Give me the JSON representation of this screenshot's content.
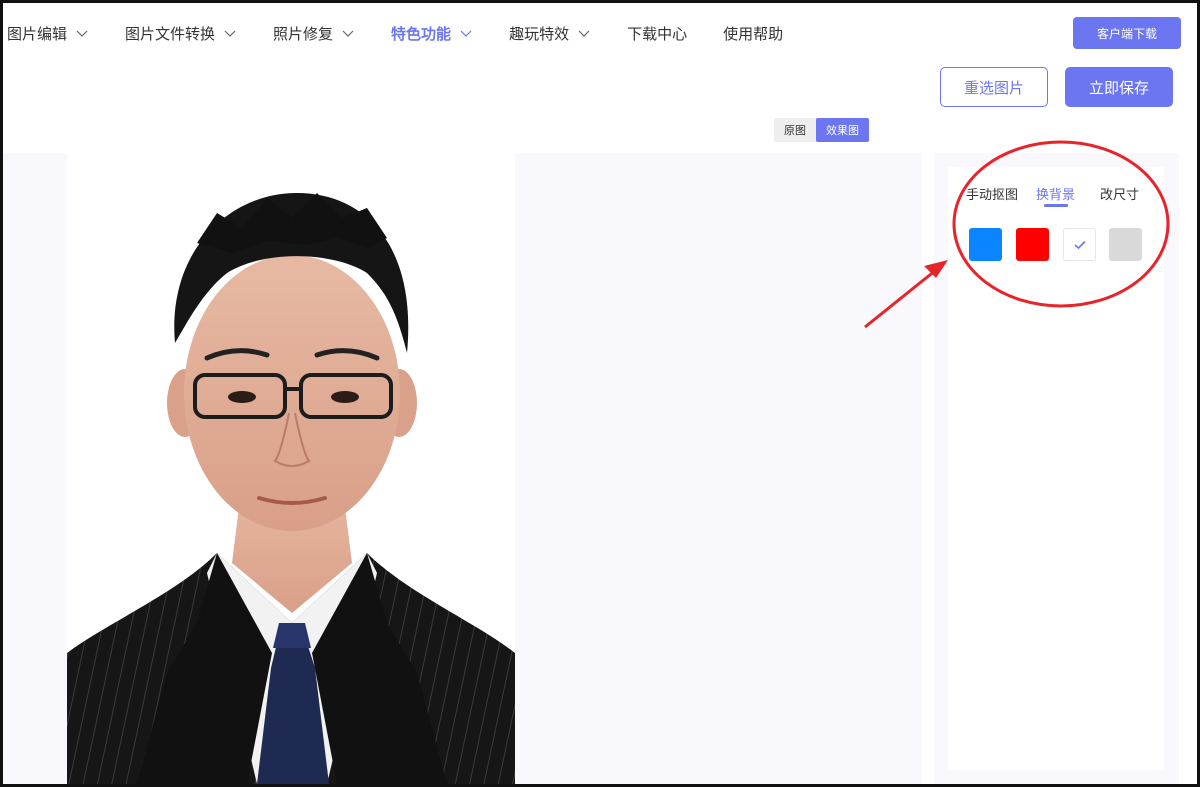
{
  "nav": {
    "items": [
      {
        "label": "图片编辑",
        "has_dropdown": true
      },
      {
        "label": "图片文件转换",
        "has_dropdown": true
      },
      {
        "label": "照片修复",
        "has_dropdown": true
      },
      {
        "label": "特色功能",
        "has_dropdown": true,
        "active": true
      },
      {
        "label": "趣玩特效",
        "has_dropdown": true
      },
      {
        "label": "下载中心",
        "has_dropdown": false
      },
      {
        "label": "使用帮助",
        "has_dropdown": false
      }
    ],
    "download_client_label": "客户端下载"
  },
  "actions": {
    "reselect_label": "重选图片",
    "save_label": "立即保存"
  },
  "view_toggle": {
    "original_label": "原图",
    "effect_label": "效果图",
    "selected": "效果图"
  },
  "panel": {
    "tabs": [
      {
        "label": "手动抠图"
      },
      {
        "label": "换背景",
        "active": true
      },
      {
        "label": "改尺寸"
      }
    ],
    "swatches": [
      {
        "name": "blue",
        "color": "#0a84ff"
      },
      {
        "name": "red",
        "color": "#ff0000"
      },
      {
        "name": "white",
        "color": "#ffffff",
        "selected": true
      },
      {
        "name": "gray",
        "color": "#d9d9d9"
      }
    ]
  },
  "colors": {
    "accent": "#6b76f0",
    "annotation": "#e8242b"
  }
}
